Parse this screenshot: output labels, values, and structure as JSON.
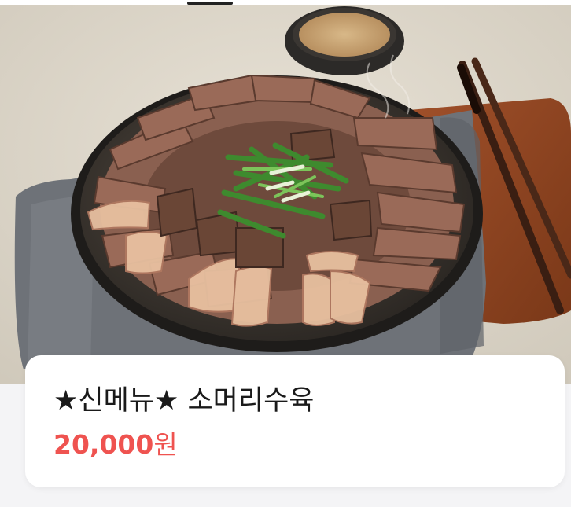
{
  "menu_item": {
    "name": "★신메뉴★ 소머리수육",
    "price": "20,000",
    "currency": "원",
    "price_color": "#ef5350"
  },
  "photo": {
    "icon": "food-photo"
  }
}
